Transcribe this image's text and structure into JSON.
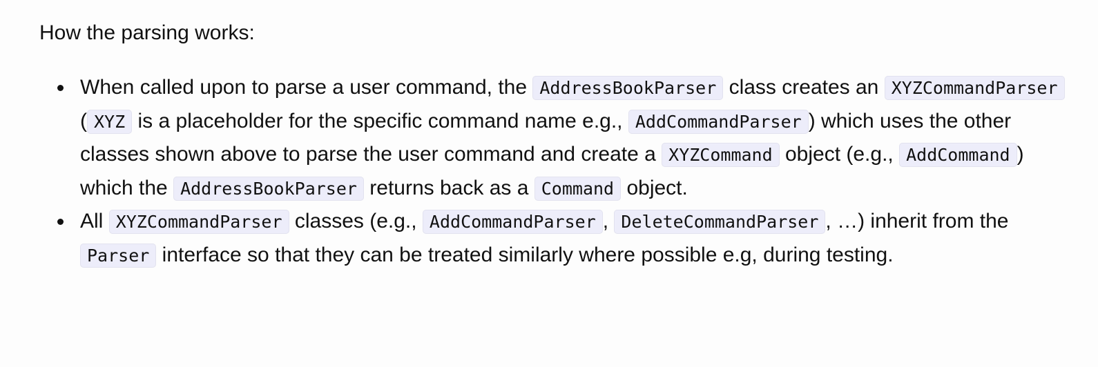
{
  "intro": "How the parsing works:",
  "bullets": [
    {
      "segments": [
        {
          "t": "When called upon to parse a user command, the "
        },
        {
          "code": "AddressBookParser"
        },
        {
          "t": " class creates an "
        },
        {
          "code": "XYZCommandParser"
        },
        {
          "t": " ("
        },
        {
          "code": "XYZ"
        },
        {
          "t": " is a placeholder for the specific command name e.g., "
        },
        {
          "code": "AddCommandParser"
        },
        {
          "t": ") which uses the other classes shown above to parse the user command and create a "
        },
        {
          "code": "XYZCommand"
        },
        {
          "t": " object (e.g., "
        },
        {
          "code": "AddCommand"
        },
        {
          "t": ") which the "
        },
        {
          "code": "AddressBookParser"
        },
        {
          "t": " returns back as a "
        },
        {
          "code": "Command"
        },
        {
          "t": " object."
        }
      ]
    },
    {
      "segments": [
        {
          "t": "All "
        },
        {
          "code": "XYZCommandParser"
        },
        {
          "t": " classes (e.g., "
        },
        {
          "code": "AddCommandParser"
        },
        {
          "t": ", "
        },
        {
          "code": "DeleteCommandParser"
        },
        {
          "t": ", …) inherit from the "
        },
        {
          "code": "Parser"
        },
        {
          "t": " interface so that they can be treated similarly where possible e.g, during testing."
        }
      ]
    }
  ]
}
